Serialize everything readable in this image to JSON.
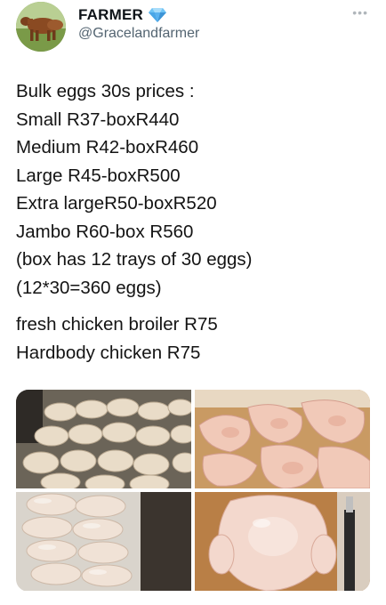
{
  "author": {
    "display_name": "FARMER",
    "handle": "@Gracelandfarmer",
    "verified_icon": "diamond-icon",
    "avatar_icon": "cow-avatar"
  },
  "tweet": {
    "lines": [
      "Bulk eggs 30s prices :",
      "Small R37-boxR440",
      "Medium R42-boxR460",
      "Large R45-boxR500",
      "Extra largeR50-boxR520",
      "Jambo R60-box R560",
      "(box has 12 trays of 30 eggs)",
      "(12*30=360 eggs)"
    ],
    "lines2": [
      "fresh chicken broiler R75",
      "Hardbody chicken R75"
    ]
  },
  "media": [
    {
      "name": "broilers-on-rack-photo"
    },
    {
      "name": "chicken-pieces-photo"
    },
    {
      "name": "bagged-chickens-photo"
    },
    {
      "name": "whole-chicken-photo"
    }
  ],
  "colors": {
    "text": "#0f1419",
    "handle": "#536471",
    "verified": "#5ab2f0"
  }
}
